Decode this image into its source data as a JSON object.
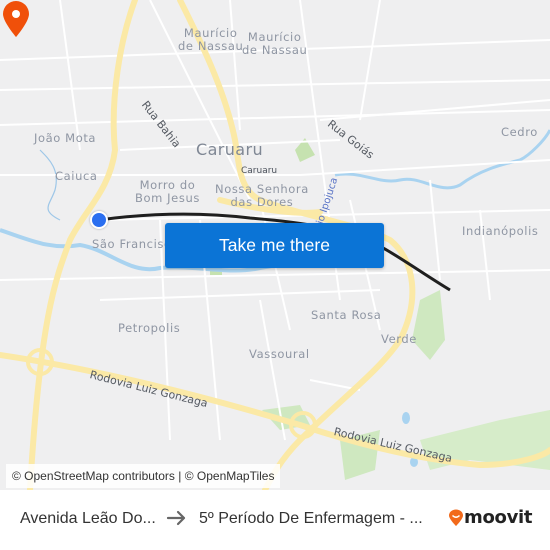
{
  "map": {
    "neighborhood_labels": [
      {
        "id": "mauricio-1",
        "text_lines": [
          "Maurício",
          "de Nassau"
        ]
      },
      {
        "id": "mauricio-2",
        "text_lines": [
          "Maurício",
          "de Nassau"
        ]
      },
      {
        "id": "joao-mota",
        "text_lines": [
          "João Mota"
        ]
      },
      {
        "id": "caiuca",
        "text_lines": [
          "Caiuca"
        ]
      },
      {
        "id": "morro",
        "text_lines": [
          "Morro do",
          "Bom Jesus"
        ]
      },
      {
        "id": "nossa-senhora",
        "text_lines": [
          "Nossa Senhora",
          "das Dores"
        ]
      },
      {
        "id": "sao-francisco",
        "text_lines": [
          "São Francisco"
        ]
      },
      {
        "id": "cedro",
        "text_lines": [
          "Cedro"
        ]
      },
      {
        "id": "indianopolis",
        "text_lines": [
          "Indianópolis"
        ]
      },
      {
        "id": "petropolis",
        "text_lines": [
          "Petropolis"
        ]
      },
      {
        "id": "santa-rosa",
        "text_lines": [
          "Santa Rosa"
        ]
      },
      {
        "id": "vassoural",
        "text_lines": [
          "Vassoural"
        ]
      },
      {
        "id": "verde",
        "text_lines": [
          "Verde"
        ]
      }
    ],
    "city_label": "Caruaru",
    "city_small_label": "Caruaru",
    "road_labels": {
      "rua_bahia": "Rua Bahia",
      "rua_goias": "Rua Goiás",
      "rodovia_1": "Rodovia Luiz Gonzaga",
      "rodovia_2": "Rodovia Luiz Gonzaga"
    },
    "river_label": "Rio Ipojuca",
    "cta_label": "Take me there",
    "attribution": "© OpenStreetMap contributors | © OpenMapTiles",
    "colors": {
      "route": "#1f1f1f",
      "origin": "#2b6ff0",
      "destination": "#f0500a",
      "cta": "#0b74d6",
      "highway": "#fbe9a6",
      "water": "#a9d3f0",
      "park": "#cfe8c0"
    }
  },
  "footer": {
    "from": "Avenida Leão Do...",
    "arrow_icon": "arrow-right-icon",
    "to": "5º Período De Enfermagem - ...",
    "brand": "moovit",
    "brand_color": "#f26a1b"
  }
}
